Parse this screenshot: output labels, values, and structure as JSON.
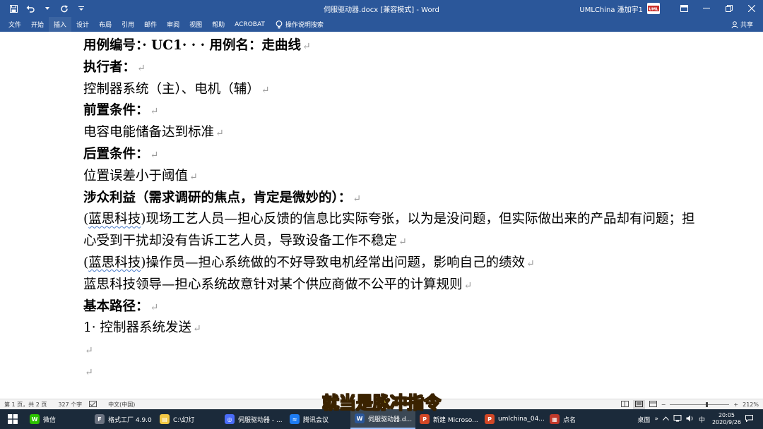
{
  "titlebar": {
    "doc_title": "伺服驱动器.docx [兼容模式]  -  Word",
    "user_name": "UMLChina 潘加宇1",
    "avatar_text": "UML"
  },
  "ribbon": {
    "tabs": [
      "文件",
      "开始",
      "插入",
      "设计",
      "布局",
      "引用",
      "邮件",
      "审阅",
      "视图",
      "帮助",
      "ACROBAT"
    ],
    "active_tab": "插入",
    "search_label": "操作说明搜索",
    "share_label": "共享"
  },
  "document": {
    "lines": [
      {
        "parts": [
          {
            "t": "用例编号：· UC1· · · 用例名：走曲线"
          }
        ],
        "bold": true
      },
      {
        "parts": [
          {
            "t": "执行者："
          }
        ],
        "bold": true
      },
      {
        "parts": [
          {
            "t": "控制器系统（主）、电机（辅）"
          }
        ],
        "bold": false
      },
      {
        "parts": [
          {
            "t": "前置条件："
          }
        ],
        "bold": true
      },
      {
        "parts": [
          {
            "t": "电容电能储备达到标准"
          }
        ],
        "bold": false
      },
      {
        "parts": [
          {
            "t": "后置条件："
          }
        ],
        "bold": true
      },
      {
        "parts": [
          {
            "t": "位置误差小于阈值"
          }
        ],
        "bold": false
      },
      {
        "parts": [
          {
            "t": "涉众利益（需求调研的焦点，肯定是微妙的）："
          }
        ],
        "bold": true
      },
      {
        "parts": [
          {
            "t": "("
          },
          {
            "t": "蓝思科技",
            "sq": true
          },
          {
            "t": ")现场工艺人员—担心反馈的信息比实际夸张，以为是没问题，但实际做出来的产品却有问题；担"
          }
        ],
        "bold": false,
        "nomark": true
      },
      {
        "parts": [
          {
            "t": "心受到干扰却没有告诉工艺人员，导致设备工作不稳定"
          }
        ],
        "bold": false
      },
      {
        "parts": [
          {
            "t": "("
          },
          {
            "t": "蓝思科技",
            "sq": true
          },
          {
            "t": ")操作员—担心系统做的不好导致电机经常出问题，影响自己的绩效"
          }
        ],
        "bold": false
      },
      {
        "parts": [
          {
            "t": "蓝思科技领导—担心系统故意针对某个供应商做不公平的计算规则"
          }
        ],
        "bold": false
      },
      {
        "parts": [
          {
            "t": "基本路径："
          }
        ],
        "bold": true
      },
      {
        "parts": [
          {
            "t": "1· 控制器系统发送"
          }
        ],
        "bold": false
      },
      {
        "parts": [
          {
            "t": ""
          }
        ],
        "bold": false
      },
      {
        "parts": [
          {
            "t": ""
          }
        ],
        "bold": false
      }
    ],
    "paragraph_mark": "↵"
  },
  "subtitle": "就当是脉冲指令",
  "statusbar": {
    "page": "第 1 页，共 2 页",
    "words": "327 个字",
    "language": "中文(中国)",
    "zoom_minus": "−",
    "zoom_plus": "+",
    "zoom": "212%",
    "zoom_fraction": 0.62
  },
  "taskbar": {
    "items": [
      {
        "label": "微信",
        "color": "#2dc100",
        "glyph": "W"
      },
      {
        "label": "格式工厂 4.9.0",
        "color": "#6b7280",
        "glyph": "F"
      },
      {
        "label": "C:\\幻灯",
        "color": "#f2c744",
        "glyph": "▤"
      },
      {
        "label": "伺服驱动器 - ...",
        "color": "#4a6cf7",
        "glyph": "◎"
      },
      {
        "label": "腾讯会议",
        "color": "#1e7cf2",
        "glyph": "≈"
      },
      {
        "label": "伺服驱动器.d...",
        "color": "#2b579a",
        "glyph": "W",
        "active": true
      },
      {
        "label": "新建 Microso...",
        "color": "#d24726",
        "glyph": "P"
      },
      {
        "label": "umlchina_04...",
        "color": "#d24726",
        "glyph": "P"
      },
      {
        "label": "点名",
        "color": "#c0392b",
        "glyph": "▦"
      }
    ],
    "desktop_label": "桌面",
    "overflow": "»",
    "ime": "中",
    "time": "20:05",
    "date": "2020/9/26"
  },
  "colors": {
    "brand": "#2b579a",
    "subtitle": "#f4e84a"
  }
}
